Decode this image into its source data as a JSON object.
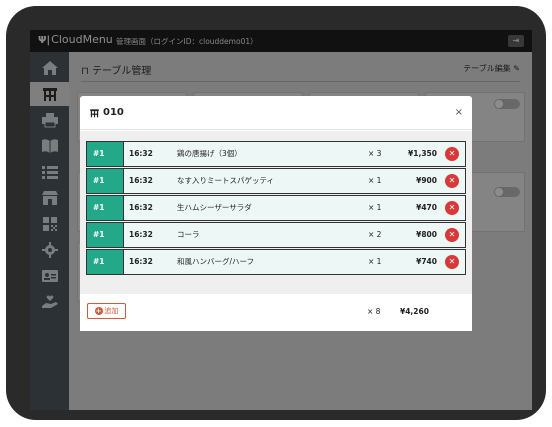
{
  "header": {
    "brand": "CloudMenu",
    "admin_title": "管理画面（ログインID：clouddemo01）",
    "logout_icon": "logout-icon"
  },
  "sidebar": {
    "items": [
      {
        "name": "home",
        "icon": "home-icon",
        "active": false
      },
      {
        "name": "tables",
        "icon": "table-icon",
        "active": true
      },
      {
        "name": "kitchen",
        "icon": "printer-icon",
        "active": false
      },
      {
        "name": "menu",
        "icon": "book-icon",
        "active": false
      },
      {
        "name": "list",
        "icon": "list-icon",
        "active": false
      },
      {
        "name": "shop",
        "icon": "shop-icon",
        "active": false
      },
      {
        "name": "qr",
        "icon": "qr-icon",
        "active": false
      },
      {
        "name": "settings",
        "icon": "gear-icon",
        "active": false
      },
      {
        "name": "staff",
        "icon": "id-card-icon",
        "active": false
      },
      {
        "name": "support",
        "icon": "hand-heart-icon",
        "active": false
      }
    ]
  },
  "page": {
    "title": "テーブル管理",
    "edit_label": "テーブル編集"
  },
  "modal": {
    "title": "010",
    "close_label": "×",
    "orders": [
      {
        "seat": "#1",
        "time": "16:32",
        "name": "鶏の唐揚げ（3個）",
        "qty": "× 3",
        "price": "¥1,350"
      },
      {
        "seat": "#1",
        "time": "16:32",
        "name": "なす入りミートスパゲッティ",
        "qty": "× 1",
        "price": "¥900"
      },
      {
        "seat": "#1",
        "time": "16:32",
        "name": "生ハムシーザーサラダ",
        "qty": "× 1",
        "price": "¥470"
      },
      {
        "seat": "#1",
        "time": "16:32",
        "name": "コーラ",
        "qty": "× 2",
        "price": "¥800"
      },
      {
        "seat": "#1",
        "time": "16:32",
        "name": "和風ハンバーグ/ハーフ",
        "qty": "× 1",
        "price": "¥740"
      }
    ],
    "add_label": "追加",
    "total_qty": "× 8",
    "total_amount": "¥4,260"
  },
  "colors": {
    "accent_teal": "#23a889",
    "delete_red": "#d83838",
    "add_orange": "#d05a3a",
    "sidebar_bg": "#4f5960",
    "header_bg": "#1f1f1f"
  }
}
